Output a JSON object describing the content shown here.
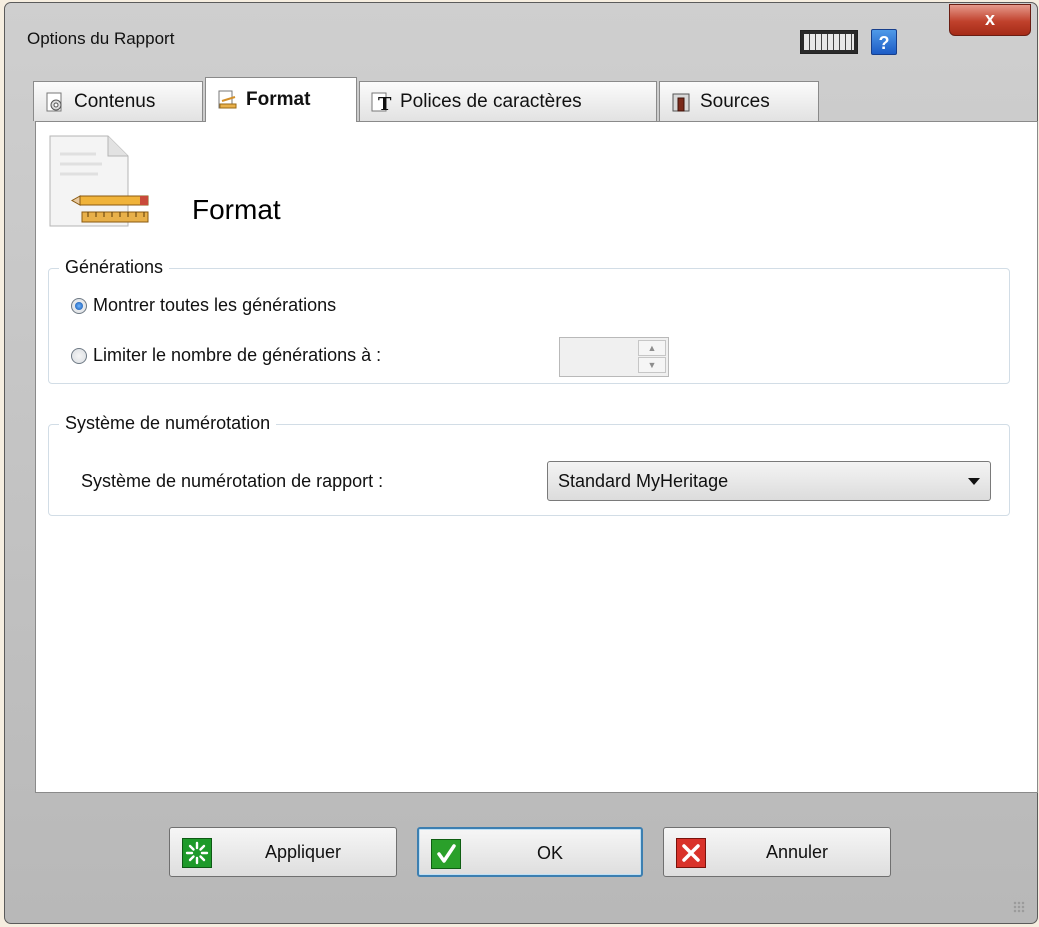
{
  "window": {
    "title": "Options du Rapport",
    "close_label": "x",
    "help_label": "?"
  },
  "tabs": [
    {
      "label": "Contenus",
      "icon": "gear-document-icon",
      "active": false
    },
    {
      "label": "Format",
      "icon": "format-document-icon",
      "active": true
    },
    {
      "label": "Polices de caractères",
      "icon": "font-icon",
      "active": false
    },
    {
      "label": "Sources",
      "icon": "sources-icon",
      "active": false
    }
  ],
  "header": {
    "title": "Format",
    "icon": "document-pencil-ruler-icon"
  },
  "generations": {
    "label": "Générations",
    "option_all": "Montrer toutes les générations",
    "option_limit": "Limiter le nombre de générations à :",
    "selected": "all",
    "limit_value": ""
  },
  "numbering": {
    "label": "Système de numérotation",
    "field_label": "Système de numérotation de rapport :",
    "selected_value": "Standard MyHeritage"
  },
  "buttons": {
    "apply_label": "Appliquer",
    "ok_label": "OK",
    "cancel_label": "Annuler"
  },
  "colors": {
    "apply_icon": "#1e9a2a",
    "ok_icon": "#2aa02a",
    "cancel_icon": "#d9322a",
    "help_icon": "#2a6fd6",
    "close_button": "#c0412c"
  }
}
